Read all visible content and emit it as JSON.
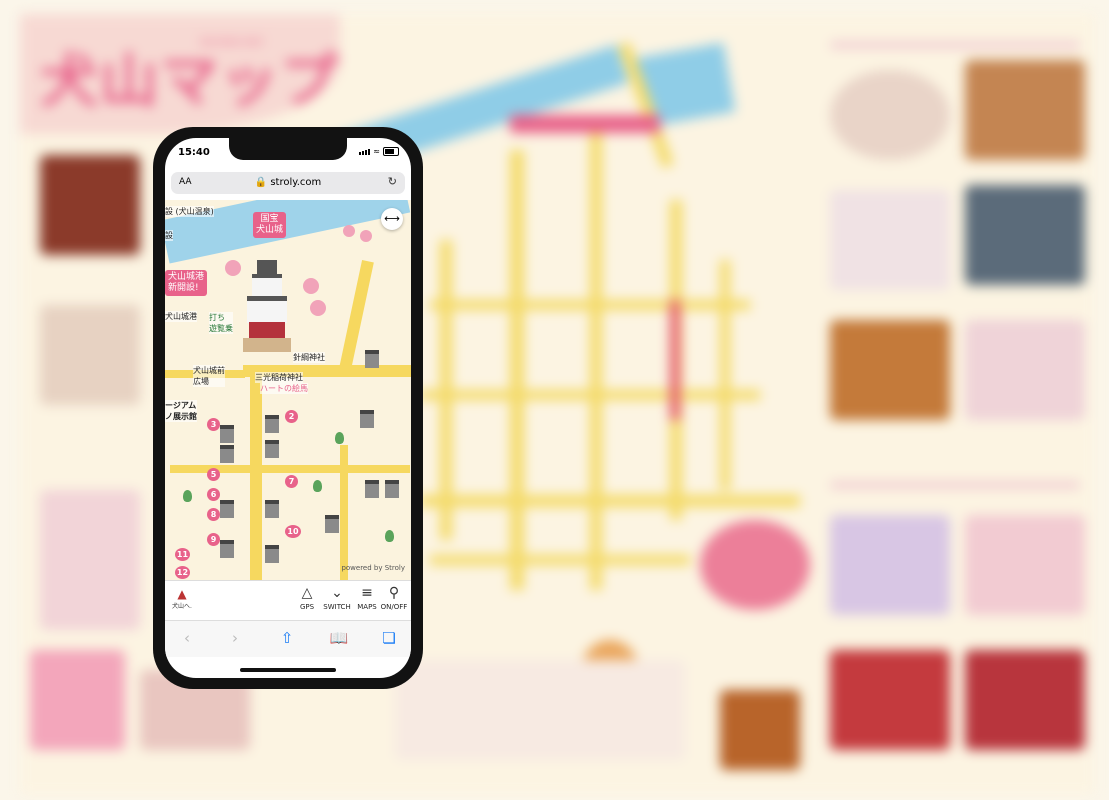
{
  "status_bar": {
    "time": "15:40"
  },
  "browser": {
    "text_size_label": "AA",
    "url": "stroly.com",
    "reload_icon": "reload-icon"
  },
  "map": {
    "labels": {
      "top_left_1": "設 (犬山温泉)",
      "top_left_2": "設",
      "castle_title_line1": "国宝",
      "castle_title_line2": "犬山城",
      "port_line1": "犬山城港",
      "port_line2": "新開設!",
      "port_name": "犬山城港",
      "boat_line1": "打ち",
      "boat_line2": "遊覧乗",
      "shrine_harikane": "針綱神社",
      "shrine_sanko": "三光稲荷神社",
      "shrine_heart": "ハートの絵馬",
      "square_line1": "犬山城前",
      "square_line2": "広場",
      "museum_line1": "ージアム",
      "museum_line2": "ノ展示館",
      "powered_by": "powered by Stroly"
    },
    "numbers": [
      "2",
      "3",
      "5",
      "6",
      "7",
      "8",
      "9",
      "10",
      "11",
      "12"
    ]
  },
  "toolbar": {
    "logo_label": "犬山へ.",
    "items": [
      {
        "label": "GPS",
        "icon": "gps-icon"
      },
      {
        "label": "SWITCH",
        "icon": "switch-map-icon"
      },
      {
        "label": "MAPS",
        "icon": "maps-layers-icon"
      },
      {
        "label": "ON/OFF",
        "icon": "location-pin-icon"
      }
    ]
  },
  "background": {
    "title": "犬山マップ",
    "subtitle": "INUYAMA MAP"
  },
  "colors": {
    "accent_pink": "#e8628a",
    "road_yellow": "#f6d85f",
    "safari_blue": "#1a7cf5"
  }
}
